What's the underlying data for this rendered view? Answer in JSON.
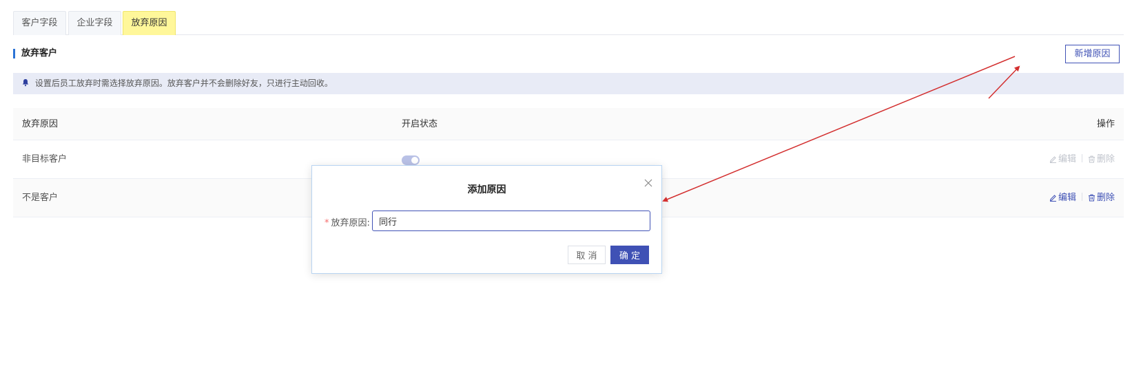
{
  "tabs": [
    {
      "label": "客户字段"
    },
    {
      "label": "企业字段"
    },
    {
      "label": "放弃原因"
    }
  ],
  "section": {
    "title": "放弃客户",
    "add_button": "新增原因"
  },
  "notice": {
    "text": "设置后员工放弃时需选择放弃原因。放弃客户并不会删除好友，只进行主动回收。",
    "icon": "bell-icon"
  },
  "table": {
    "headers": [
      "放弃原因",
      "开启状态",
      "操作"
    ],
    "rows": [
      {
        "reason": "非目标客户",
        "enabled": true,
        "edit": "编辑",
        "delete": "删除",
        "actions_disabled": true
      },
      {
        "reason": "不是客户",
        "enabled": true,
        "edit": "编辑",
        "delete": "删除",
        "actions_disabled": false
      }
    ]
  },
  "dialog": {
    "title": "添加原因",
    "field_label": "放弃原因:",
    "field_required": "*",
    "field_value": "同行",
    "cancel": "取 消",
    "confirm": "确 定"
  },
  "colors": {
    "accent": "#3f51b5",
    "active_tab": "#fff79a",
    "notice_bg": "#e8ebf6",
    "annotation_arrow": "#d32f2f"
  }
}
